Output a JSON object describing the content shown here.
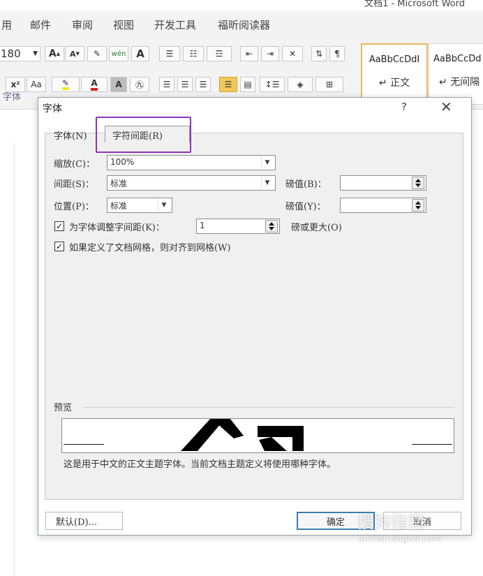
{
  "window": {
    "title": "文档1 - Microsoft Word"
  },
  "menu": [
    "用",
    "邮件",
    "审阅",
    "视图",
    "开发工具",
    "福昕阅读器"
  ],
  "ribbon": {
    "font_size": "180",
    "font_group_label": "字体",
    "grow_font": "A",
    "shrink_font": "A",
    "change_case": "Aa",
    "superscript": "x²",
    "highlight_color": "#f5e61c",
    "font_color": "#e02020",
    "style_gallery": [
      {
        "sample": "AaBbCcDdI",
        "name": "正文"
      },
      {
        "sample": "AaBbCcDd",
        "name": "无间隔"
      }
    ]
  },
  "dialog": {
    "title": "字体",
    "help": "?",
    "close": "✕",
    "tabs": [
      {
        "label": "字体(N)",
        "active": false
      },
      {
        "label": "字符间距(R)",
        "active": true
      }
    ],
    "scale": {
      "label": "缩放(C)：",
      "value": "100%"
    },
    "spacing": {
      "label": "间距(S)：",
      "value": "标准",
      "points_label": "磅值(B)：",
      "points_value": ""
    },
    "position": {
      "label": "位置(P)：",
      "value": "标准",
      "points_label": "磅值(Y)：",
      "points_value": ""
    },
    "kerning": {
      "checked": true,
      "label": "为字体调整字间距(K)：",
      "value": "1",
      "suffix": "磅或更大(O)"
    },
    "snap_grid": {
      "checked": true,
      "label": "如果定义了文档网格，则对齐到网格(W)"
    },
    "preview": {
      "label": "预览",
      "caption": "这是用于中文的正文主题字体。当前文档主题定义将使用哪种字体。"
    },
    "buttons": {
      "default": "默认(D)...",
      "ok": "确定",
      "cancel": "取消"
    }
  },
  "watermark": {
    "text": "搜狗指南",
    "url": "zhinan.sogou.com"
  },
  "colors": {
    "highlight_box": "#8b36b8",
    "default_button_border": "#3c7fb1"
  }
}
